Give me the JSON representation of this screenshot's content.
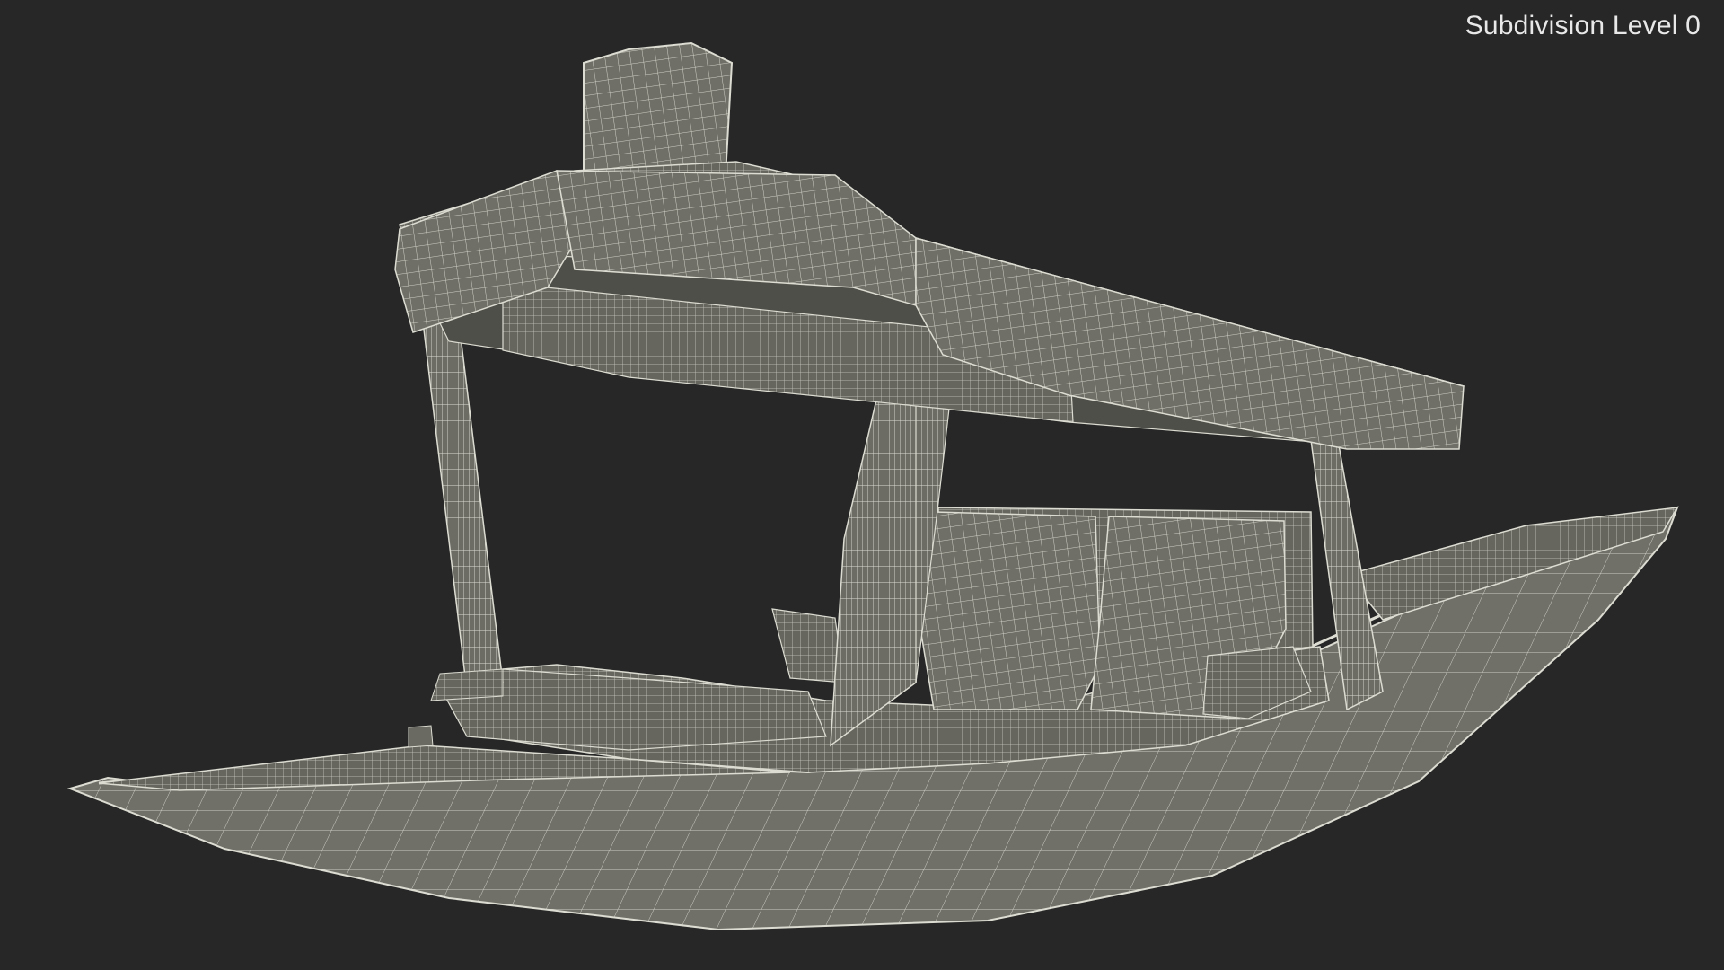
{
  "viewport": {
    "subdivision_label": "Subdivision Level 0",
    "background_color": "#272727",
    "model_fill_color": "#6f6f67",
    "wire_color": "#dcdcd2"
  },
  "model": {
    "subject": "shikara-boat",
    "render_mode": "wireframe-on-shaded"
  }
}
